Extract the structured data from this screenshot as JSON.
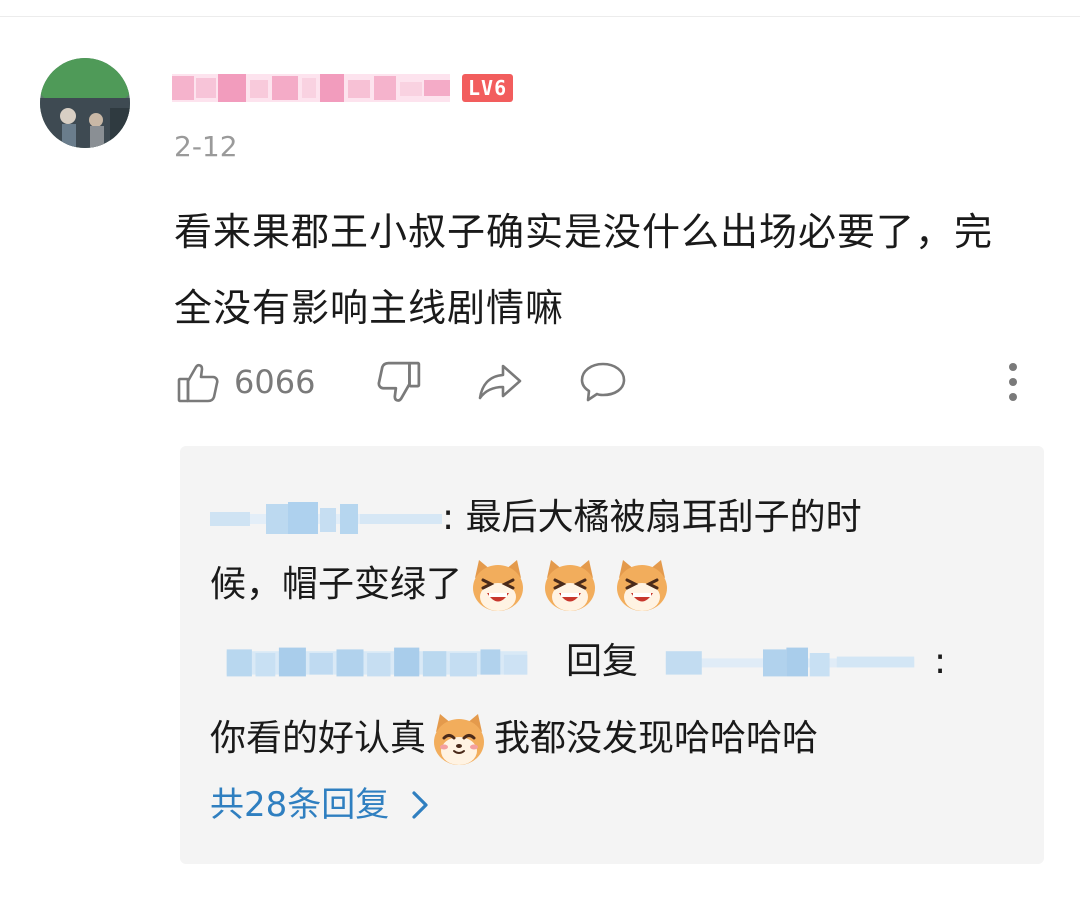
{
  "comment": {
    "level_badge": "LV6",
    "date": "2-12",
    "text": "看来果郡王小叔子确实是没什么出场必要了，完全没有影响主线剧情嘛",
    "actions": {
      "like_count": "6066",
      "icons": [
        "thumbs-up-icon",
        "thumbs-down-icon",
        "share-icon",
        "comment-icon",
        "more-icon"
      ]
    }
  },
  "replies": [
    {
      "text_line1": ": 最后大橘被扇耳刮子的时",
      "text_line2": "候，帽子变绿了"
    },
    {
      "reply_word": "回复",
      "colon": ":",
      "text_before": "你看的好认真",
      "text_after": "我都没发现哈哈哈哈"
    }
  ],
  "more_replies": {
    "label": "共28条回复"
  },
  "colors": {
    "badge": "#f25d5d",
    "link": "#2f7fc0",
    "reply_bg": "#f4f4f4",
    "date": "#9a9a9a"
  }
}
